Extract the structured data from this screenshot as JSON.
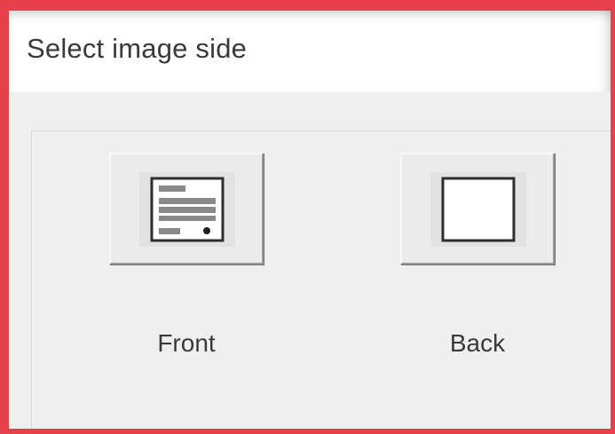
{
  "dialog": {
    "title": "Select image side",
    "accent_border_color": "#e8404a"
  },
  "options": [
    {
      "label": "Front",
      "icon": "id-card-front-icon"
    },
    {
      "label": "Back",
      "icon": "blank-card-back-icon"
    }
  ]
}
